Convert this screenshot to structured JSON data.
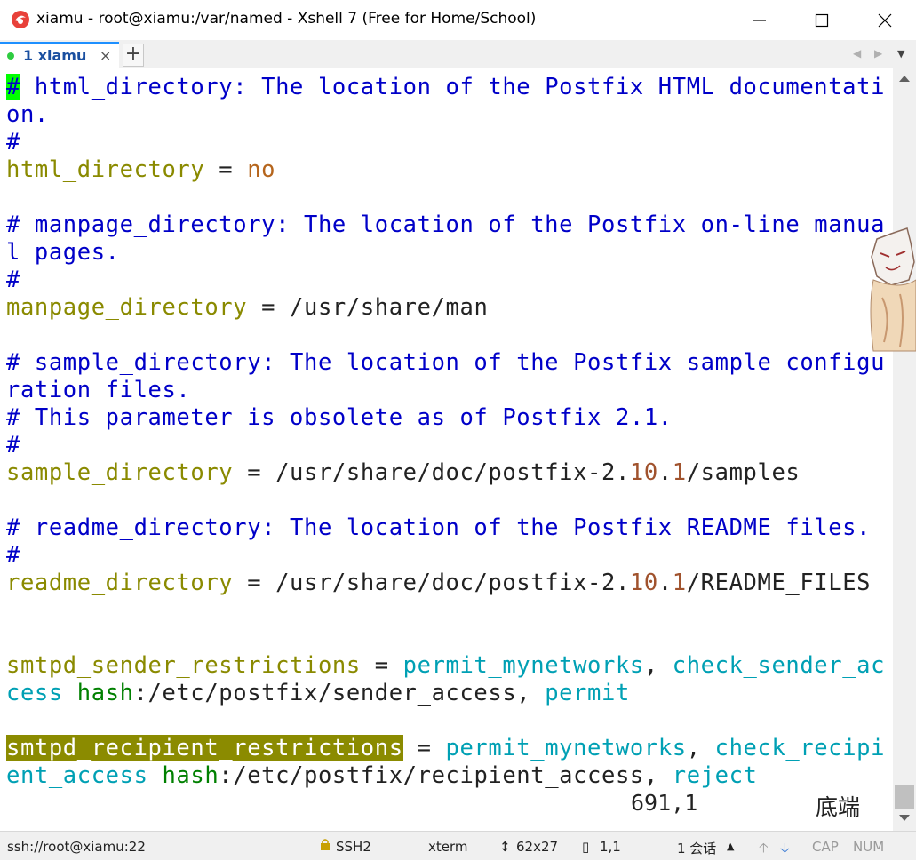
{
  "window": {
    "title": "xiamu - root@xiamu:/var/named - Xshell 7 (Free for Home/School)"
  },
  "tabs": [
    {
      "label": "1 xiamu",
      "close": "×"
    }
  ],
  "tabbar": {
    "add": "+",
    "nav_left": "◀",
    "nav_right": "▶",
    "menu": "▼"
  },
  "terminal": {
    "lines": [
      {
        "segments": [
          {
            "t": "#",
            "c": "cursor"
          },
          {
            "t": " html_directory: The location of the Postfix HTML documentati",
            "c": "c-comment"
          }
        ]
      },
      {
        "segments": [
          {
            "t": "on.",
            "c": "c-comment"
          }
        ]
      },
      {
        "segments": [
          {
            "t": "#",
            "c": "c-comment"
          }
        ]
      },
      {
        "segments": [
          {
            "t": "html_directory",
            "c": "c-key"
          },
          {
            "t": " = ",
            "c": "c-plain"
          },
          {
            "t": "no",
            "c": "c-val"
          }
        ]
      },
      {
        "segments": []
      },
      {
        "segments": [
          {
            "t": "# manpage_directory: The location of the Postfix on-line manua",
            "c": "c-comment"
          }
        ]
      },
      {
        "segments": [
          {
            "t": "l pages.",
            "c": "c-comment"
          }
        ]
      },
      {
        "segments": [
          {
            "t": "#",
            "c": "c-comment"
          }
        ]
      },
      {
        "segments": [
          {
            "t": "manpage_directory",
            "c": "c-key"
          },
          {
            "t": " = /usr/share/man",
            "c": "c-plain"
          }
        ]
      },
      {
        "segments": []
      },
      {
        "segments": [
          {
            "t": "# sample_directory: The location of the Postfix sample configu",
            "c": "c-comment"
          }
        ]
      },
      {
        "segments": [
          {
            "t": "ration files.",
            "c": "c-comment"
          }
        ]
      },
      {
        "segments": [
          {
            "t": "# This parameter is obsolete as of Postfix 2.1.",
            "c": "c-comment"
          }
        ]
      },
      {
        "segments": [
          {
            "t": "#",
            "c": "c-comment"
          }
        ]
      },
      {
        "segments": [
          {
            "t": "sample_directory",
            "c": "c-key"
          },
          {
            "t": " = /usr/share/doc/postfix-2.",
            "c": "c-plain"
          },
          {
            "t": "10",
            "c": "c-num"
          },
          {
            "t": ".",
            "c": "c-plain"
          },
          {
            "t": "1",
            "c": "c-num"
          },
          {
            "t": "/samples",
            "c": "c-plain"
          }
        ]
      },
      {
        "segments": []
      },
      {
        "segments": [
          {
            "t": "# readme_directory: The location of the Postfix README files.",
            "c": "c-comment"
          }
        ]
      },
      {
        "segments": [
          {
            "t": "#",
            "c": "c-comment"
          }
        ]
      },
      {
        "segments": [
          {
            "t": "readme_directory",
            "c": "c-key"
          },
          {
            "t": " = /usr/share/doc/postfix-2.",
            "c": "c-plain"
          },
          {
            "t": "10",
            "c": "c-num"
          },
          {
            "t": ".",
            "c": "c-plain"
          },
          {
            "t": "1",
            "c": "c-num"
          },
          {
            "t": "/README_FILES",
            "c": "c-plain"
          }
        ]
      },
      {
        "segments": []
      },
      {
        "segments": []
      },
      {
        "segments": [
          {
            "t": "smtpd_sender_restrictions",
            "c": "c-key"
          },
          {
            "t": " = ",
            "c": "c-plain"
          },
          {
            "t": "permit_mynetworks",
            "c": "c-cyan"
          },
          {
            "t": ", ",
            "c": "c-plain"
          },
          {
            "t": "check_sender_ac",
            "c": "c-cyan"
          }
        ]
      },
      {
        "segments": [
          {
            "t": "cess",
            "c": "c-cyan"
          },
          {
            "t": " ",
            "c": "c-plain"
          },
          {
            "t": "hash",
            "c": "c-green"
          },
          {
            "t": ":/etc/postfix/sender_access, ",
            "c": "c-plain"
          },
          {
            "t": "permit",
            "c": "c-cyan"
          }
        ]
      },
      {
        "segments": []
      },
      {
        "segments": [
          {
            "t": "smtpd_recipient_restrictions",
            "c": "hl"
          },
          {
            "t": " = ",
            "c": "c-plain"
          },
          {
            "t": "permit_mynetworks",
            "c": "c-cyan"
          },
          {
            "t": ", ",
            "c": "c-plain"
          },
          {
            "t": "check_recipi",
            "c": "c-cyan"
          }
        ]
      },
      {
        "segments": [
          {
            "t": "ent_access",
            "c": "c-cyan"
          },
          {
            "t": " ",
            "c": "c-plain"
          },
          {
            "t": "hash",
            "c": "c-green"
          },
          {
            "t": ":/etc/postfix/recipient_access, ",
            "c": "c-plain"
          },
          {
            "t": "reject",
            "c": "c-cyan"
          }
        ]
      }
    ],
    "cursor_position": "691,1",
    "scroll_indicator": "底端"
  },
  "statusbar": {
    "connection": "ssh://root@xiamu:22",
    "protocol": "SSH2",
    "terminal_type": "xterm",
    "size": "62x27",
    "position": "1,1",
    "sessions": "1 会话",
    "cap": "CAP",
    "num": "NUM"
  },
  "colors": {
    "comment": "#0000c8",
    "key": "#8a8a00",
    "value": "#b5651d",
    "cyan": "#00a0b4",
    "cursor": "#00ff00",
    "highlight": "#8b8b00",
    "tab_accent": "#1e90ff"
  },
  "icons": {
    "app": "xshell-logo-icon",
    "minimize": "minimize-icon",
    "maximize": "maximize-icon",
    "close": "close-icon",
    "lock": "lock-icon",
    "size": "resize-icon",
    "position": "cursor-position-icon",
    "up": "arrow-up-icon",
    "down": "arrow-down-icon",
    "mascot": "mascot-icon"
  }
}
